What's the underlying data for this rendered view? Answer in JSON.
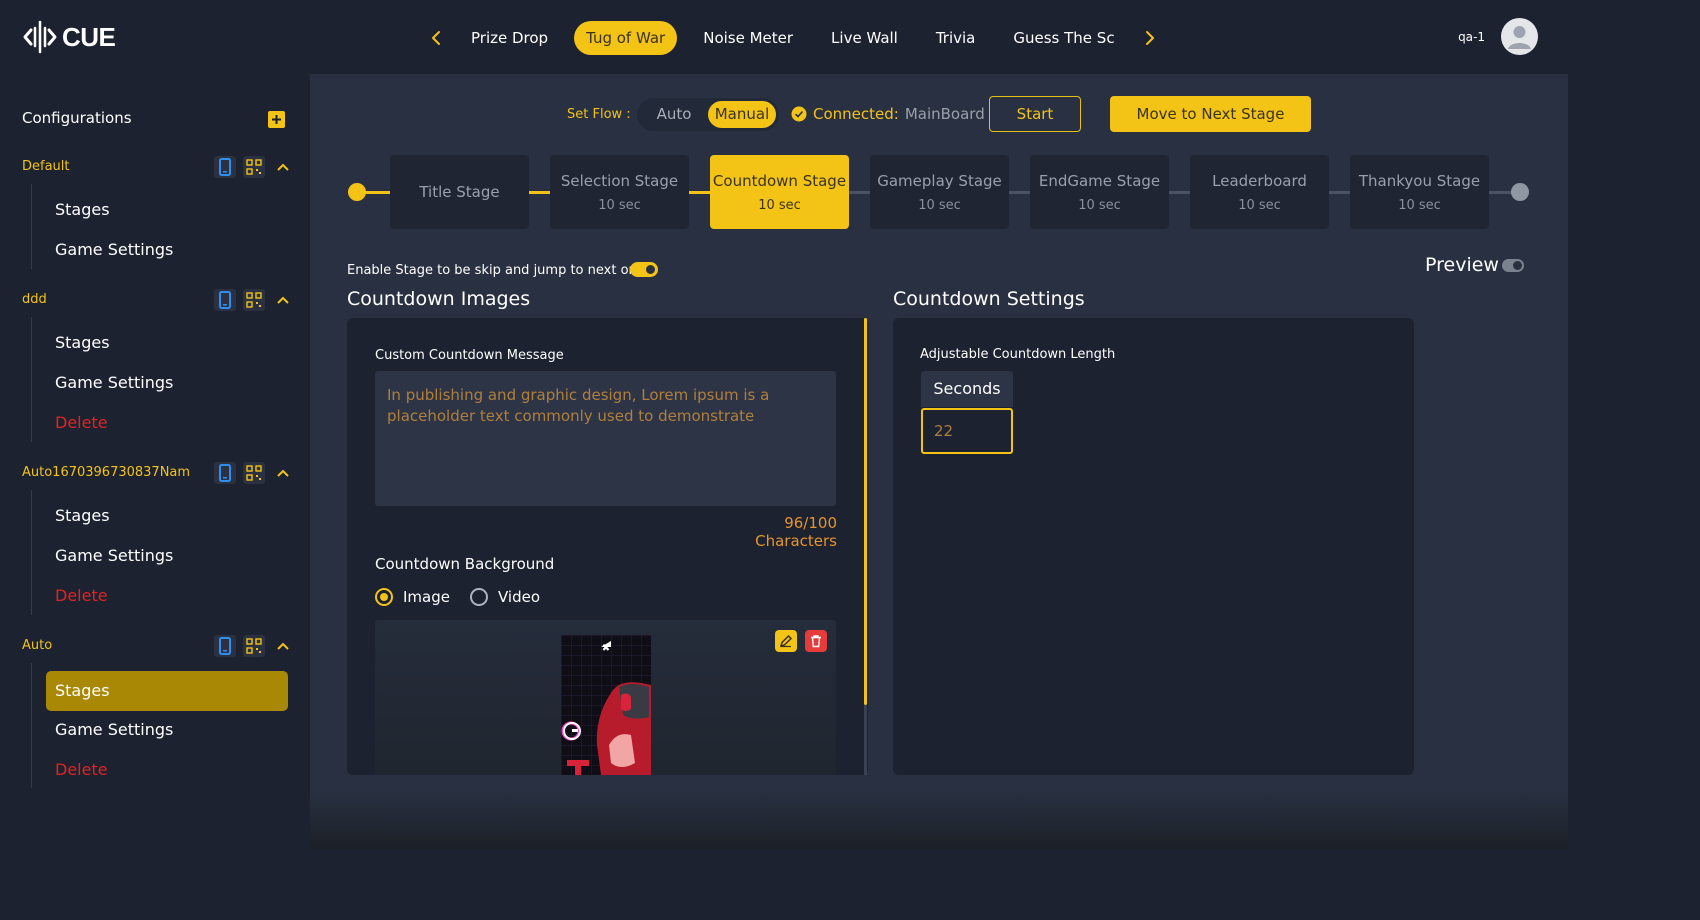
{
  "brand": {
    "name": "CUE"
  },
  "nav": {
    "tabs": [
      {
        "label": "Prize Drop"
      },
      {
        "label": "Tug of War"
      },
      {
        "label": "Noise Meter"
      },
      {
        "label": "Live Wall"
      },
      {
        "label": "Trivia"
      },
      {
        "label": "Guess The Sc"
      }
    ],
    "active_tab": "Tug of War"
  },
  "user": {
    "name": "qa-1"
  },
  "sidebar": {
    "title": "Configurations",
    "groups": [
      {
        "name": "Default",
        "items": [
          {
            "label": "Stages"
          },
          {
            "label": "Game Settings"
          }
        ]
      },
      {
        "name": "ddd",
        "items": [
          {
            "label": "Stages"
          },
          {
            "label": "Game Settings"
          },
          {
            "label": "Delete"
          }
        ]
      },
      {
        "name": "Auto1670396730837Nam",
        "items": [
          {
            "label": "Stages"
          },
          {
            "label": "Game Settings"
          },
          {
            "label": "Delete"
          }
        ]
      },
      {
        "name": "Auto",
        "items": [
          {
            "label": "Stages"
          },
          {
            "label": "Game Settings"
          },
          {
            "label": "Delete"
          }
        ]
      }
    ],
    "active_item": "Auto / Stages"
  },
  "flow": {
    "label": "Set Flow :",
    "options": [
      {
        "label": "Auto"
      },
      {
        "label": "Manual"
      }
    ],
    "selected": "Manual",
    "connected_label": "Connected:",
    "board": "MainBoard",
    "start_label": "Start",
    "next_label": "Move to Next Stage"
  },
  "stages": [
    {
      "name": "Title Stage",
      "time": ""
    },
    {
      "name": "Selection Stage",
      "time": "10 sec"
    },
    {
      "name": "Countdown Stage",
      "time": "10 sec"
    },
    {
      "name": "Gameplay Stage",
      "time": "10 sec"
    },
    {
      "name": "EndGame Stage",
      "time": "10 sec"
    },
    {
      "name": "Leaderboard",
      "time": "10 sec"
    },
    {
      "name": "Thankyou Stage",
      "time": "10 sec"
    }
  ],
  "active_stage": "Countdown Stage",
  "skip_label": "Enable Stage to be skip and jump to next one",
  "skip_enabled": true,
  "preview": {
    "label": "Preview",
    "enabled": false
  },
  "countdown_images": {
    "title": "Countdown Images",
    "message_label": "Custom Countdown Message",
    "message_value": "In publishing and graphic design, Lorem ipsum is a placeholder text commonly used to demonstrate",
    "char_count": "96/100 Characters",
    "background_label": "Countdown Background",
    "background_options": [
      {
        "label": "Image"
      },
      {
        "label": "Video"
      }
    ],
    "background_selected": "Image"
  },
  "countdown_settings": {
    "title": "Countdown Settings",
    "length_label": "Adjustable Countdown Length",
    "unit": "Seconds",
    "value": "22"
  },
  "colors": {
    "accent": "#f3c316",
    "danger": "#e02424",
    "background": "#1c2230",
    "panel": "#283041"
  }
}
